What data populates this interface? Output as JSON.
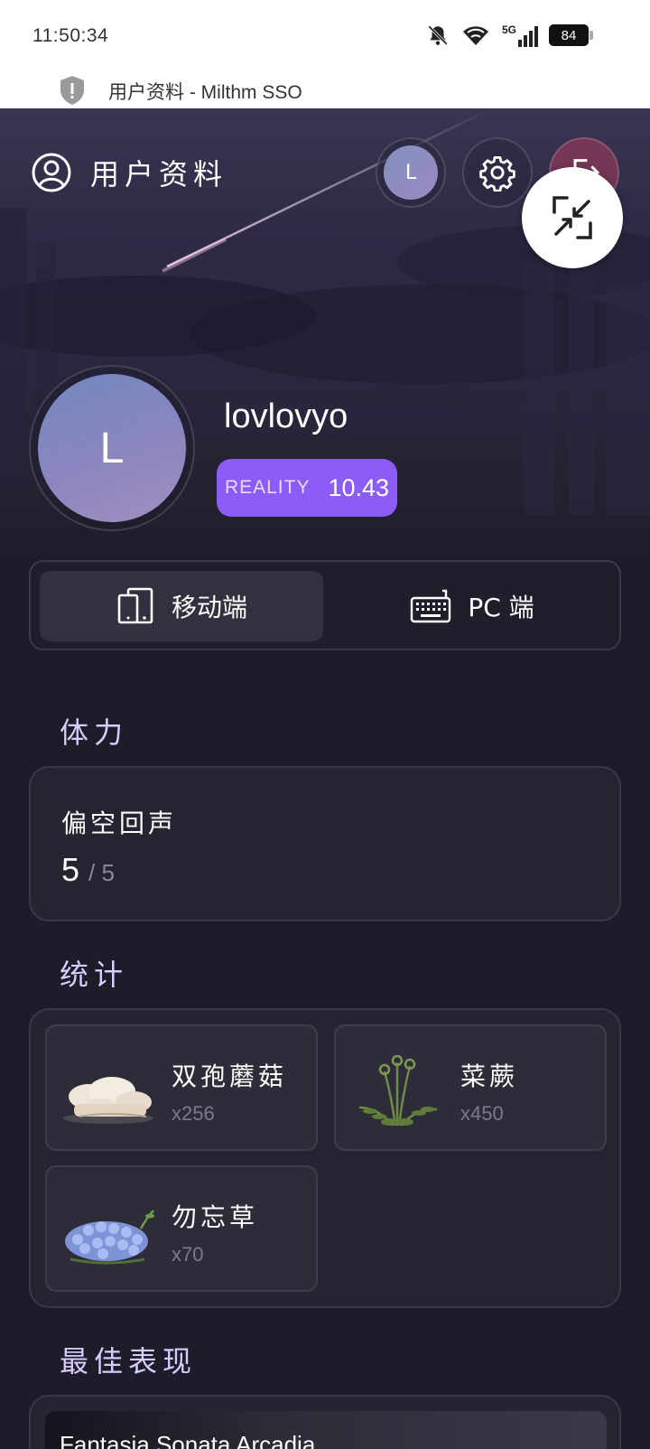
{
  "status_bar": {
    "time": "11:50:34",
    "network": "5G",
    "battery": "84"
  },
  "browser": {
    "page_title": "用户资料 - Milthm SSO"
  },
  "header": {
    "title": "用户资料",
    "avatar_initial": "L"
  },
  "profile": {
    "initial": "L",
    "username": "lovlovyo",
    "rating_label": "REALITY",
    "rating_value": "10.43"
  },
  "platform_tabs": [
    {
      "label": "移动端",
      "active": true
    },
    {
      "label": "PC 端",
      "active": false
    }
  ],
  "sections": {
    "stamina": "体力",
    "stats": "统计",
    "best": "最佳表现"
  },
  "stamina": {
    "name": "偏空回声",
    "current": "5",
    "max": "/ 5"
  },
  "stats": [
    {
      "name": "双孢蘑菇",
      "count": "x256",
      "icon": "mushroom-image"
    },
    {
      "name": "菜蕨",
      "count": "x450",
      "icon": "fern-image"
    },
    {
      "name": "勿忘草",
      "count": "x70",
      "icon": "forget-me-not-image"
    }
  ],
  "best": {
    "song": "Fantasia Sonata Arcadia"
  },
  "colors": {
    "accent": "#8b5cf6",
    "section_title": "#d8ccff",
    "background": "#1d1c28"
  }
}
